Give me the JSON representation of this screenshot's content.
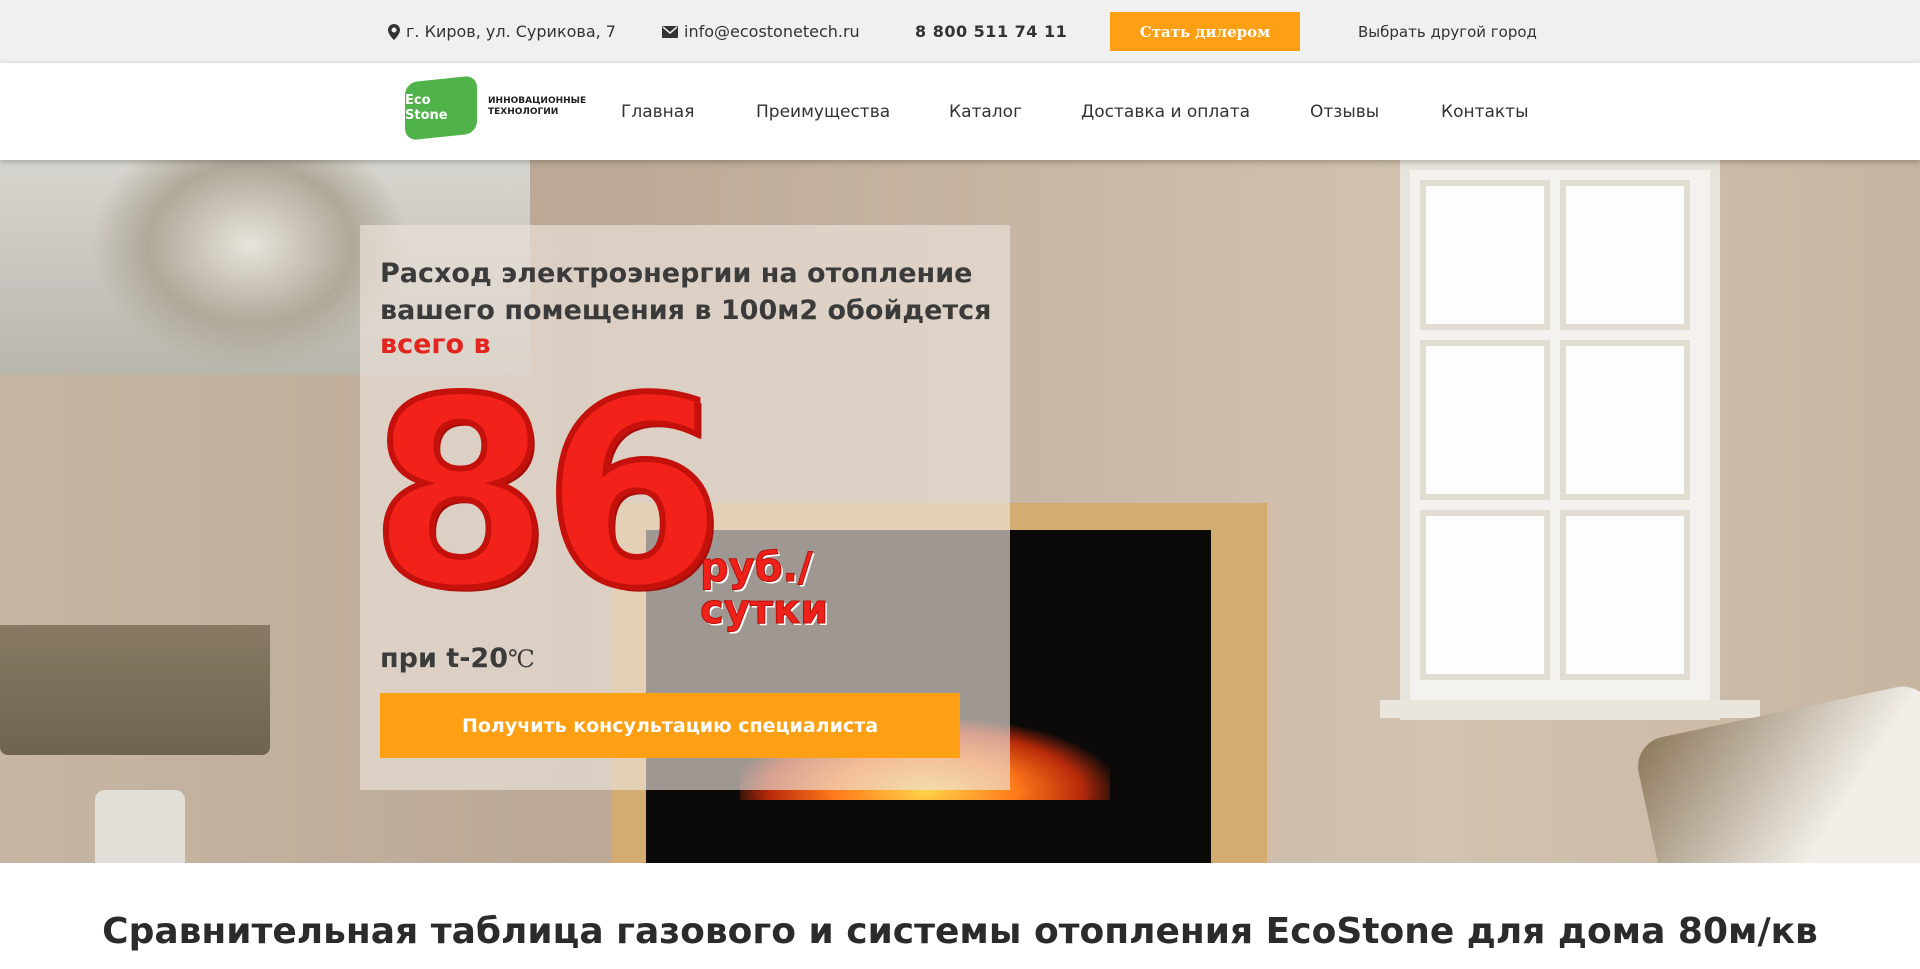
{
  "topbar": {
    "address": "г. Киров, ул. Сурикова, 7",
    "email": "info@ecostonetech.ru",
    "phone": "8 800 511 74 11",
    "dealer_button": "Стать дилером",
    "city_link": "Выбрать другой город",
    "background": "#f0f0f0",
    "accent": "#ff9f14"
  },
  "logo": {
    "badge": "Eco Stone",
    "tagline_1": "ИННОВАЦИОННЫЕ",
    "tagline_2": "ТЕХНОЛОГИИ",
    "color": "#4fb34a"
  },
  "nav": {
    "items": [
      {
        "label": "Главная"
      },
      {
        "label": "Преимущества"
      },
      {
        "label": "Каталог"
      },
      {
        "label": "Доставка и оплата"
      },
      {
        "label": "Отзывы"
      },
      {
        "label": "Контакты"
      }
    ]
  },
  "hero": {
    "text_1": "Расход электроэнергии на отопление вашего помещения в 100м2 обойдется",
    "accent_text": "всего в",
    "big_number": "86",
    "unit_1": "руб./",
    "unit_2": "сутки",
    "temp_label": "при t-20",
    "temp_unit": "℃",
    "cta_label": "Получить консультацию специалиста",
    "accent_color": "#e3251f"
  },
  "section": {
    "title": "Сравнительная таблица газового и системы отопления EcoStone для дома 80м/кв"
  },
  "icons": {
    "address": "map-pin-icon",
    "email": "envelope-icon"
  }
}
